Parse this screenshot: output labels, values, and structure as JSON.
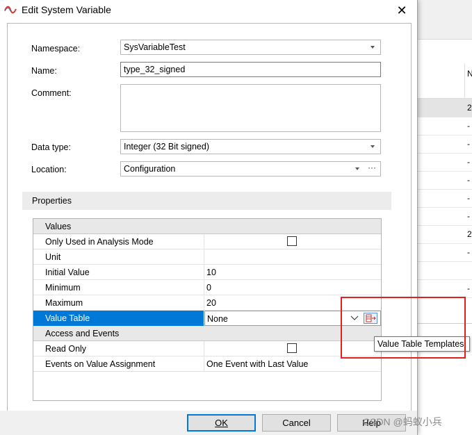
{
  "background": {
    "header_cell": "N",
    "rows": [
      "2",
      "-",
      "-",
      "-",
      "-",
      "-",
      "-",
      "2",
      "-",
      "",
      "-"
    ]
  },
  "dialog": {
    "title": "Edit System Variable",
    "close_symbol": "✕",
    "accent_color": "#0078d7",
    "form": {
      "namespace_label": "Namespace:",
      "namespace_value": "SysVariableTest",
      "name_label": "Name:",
      "name_value": "type_32_signed",
      "comment_label": "Comment:",
      "comment_value": "",
      "datatype_label": "Data type:",
      "datatype_value": "Integer (32 Bit signed)",
      "location_label": "Location:",
      "location_value": "Configuration",
      "location_more": "···"
    },
    "properties": {
      "header": "Properties",
      "groups": [
        {
          "name": "Values",
          "rows": [
            {
              "name": "Only Used in Analysis Mode",
              "value": "",
              "checkbox": true
            },
            {
              "name": "Unit",
              "value": ""
            },
            {
              "name": "Initial Value",
              "value": "10"
            },
            {
              "name": "Minimum",
              "value": "0"
            },
            {
              "name": "Maximum",
              "value": "20"
            },
            {
              "name": "Value Table",
              "value": "None",
              "selected": true
            }
          ]
        },
        {
          "name": "Access and Events",
          "rows": [
            {
              "name": "Read Only",
              "value": "",
              "checkbox": true
            },
            {
              "name": "Events on Value Assignment",
              "value": "One Event with Last Value"
            }
          ]
        }
      ]
    },
    "tooltip": "Value Table Templates",
    "buttons": {
      "ok": "OK",
      "cancel": "Cancel",
      "help": "Help"
    }
  },
  "watermark": "CSDN @蚂蚁小兵"
}
